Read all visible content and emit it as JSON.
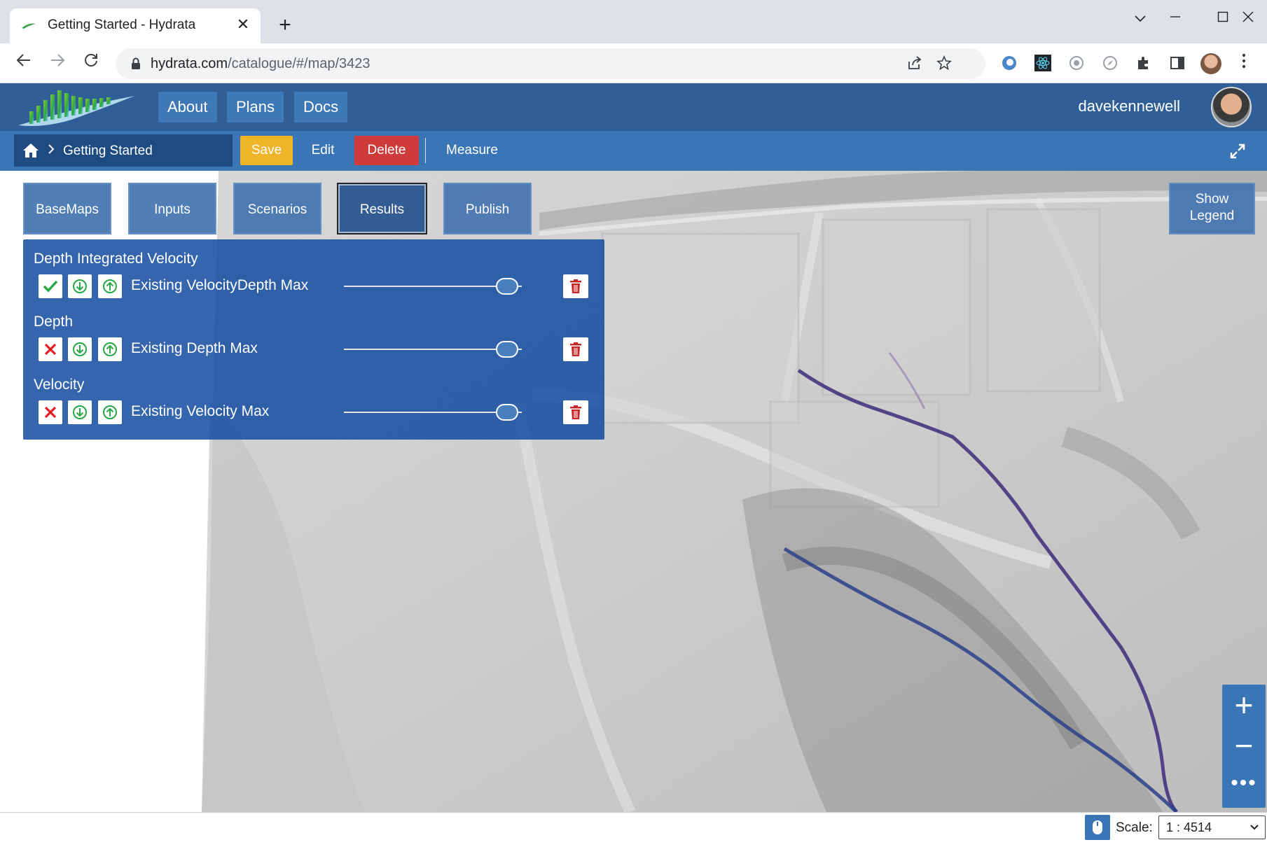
{
  "browser": {
    "tab_title": "Getting Started - Hydrata",
    "url_host": "hydrata.com",
    "url_path": "/catalogue/#/map/3423",
    "close_tab_glyph": "✕",
    "new_tab_glyph": "+"
  },
  "header": {
    "nav": [
      "About",
      "Plans",
      "Docs"
    ],
    "username": "davekennewell"
  },
  "subbar": {
    "breadcrumb": "Getting Started",
    "save_label": "Save",
    "edit_label": "Edit",
    "delete_label": "Delete",
    "measure_label": "Measure"
  },
  "panel_tabs": [
    "BaseMaps",
    "Inputs",
    "Scenarios",
    "Results",
    "Publish"
  ],
  "active_tab": "Results",
  "legend_button": {
    "line1": "Show",
    "line2": "Legend"
  },
  "results": {
    "groups": [
      {
        "title": "Depth Integrated Velocity",
        "layers": [
          {
            "name": "Existing VelocityDepth Max",
            "visible": true,
            "opacity": 0.93
          }
        ]
      },
      {
        "title": "Depth",
        "layers": [
          {
            "name": "Existing Depth Max",
            "visible": false,
            "opacity": 0.93
          }
        ]
      },
      {
        "title": "Velocity",
        "layers": [
          {
            "name": "Existing Velocity Max",
            "visible": false,
            "opacity": 0.93
          }
        ]
      }
    ]
  },
  "zoom": {
    "in_label": "+",
    "out_label": "−",
    "more_label": "•••"
  },
  "footer": {
    "scale_label": "Scale:",
    "scale_value": "1 : 4514"
  },
  "colors": {
    "header_bg": "#2f5f96",
    "subbar_bg": "#3a76b5",
    "save": "#f0b429",
    "delete": "#cf3b3b",
    "flow_path": "#3d2a7a"
  }
}
